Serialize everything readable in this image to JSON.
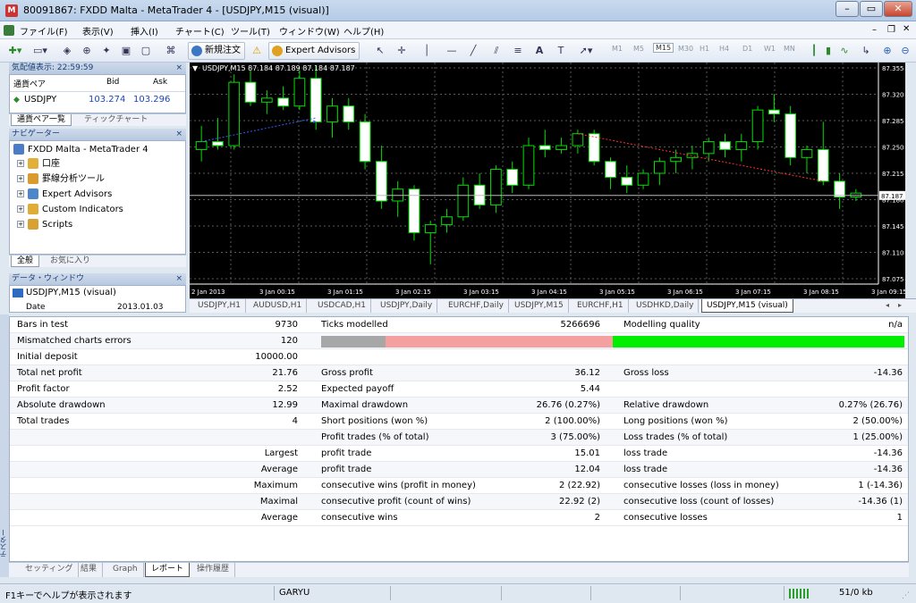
{
  "window": {
    "title": "80091867: FXDD Malta - MetaTrader 4 - [USDJPY,M15 (visual)]"
  },
  "menu": [
    "ファイル(F)",
    "表示(V)",
    "挿入(I)",
    "チャート(C)",
    "ツール(T)",
    "ウィンドウ(W)",
    "ヘルプ(H)"
  ],
  "toolbar": {
    "new_order": "新規注文",
    "expert_advisors": "Expert Advisors",
    "timeframes": [
      "M1",
      "M5",
      "M15",
      "M30",
      "H1",
      "H4",
      "D1",
      "W1",
      "MN"
    ],
    "active_timeframe": "M15"
  },
  "market_watch": {
    "header": "気配値表示: 22:59:59",
    "columns": [
      "通貨ペア",
      "Bid",
      "Ask"
    ],
    "rows": [
      {
        "symbol": "USDJPY",
        "bid": "103.274",
        "ask": "103.296"
      }
    ],
    "tabs": [
      "通貨ペア一覧",
      "ティックチャート"
    ]
  },
  "navigator": {
    "header": "ナビゲーター",
    "root": "FXDD Malta - MetaTrader 4",
    "items": [
      "口座",
      "罫線分析ツール",
      "Expert Advisors",
      "Custom Indicators",
      "Scripts"
    ],
    "tabs": [
      "全般",
      "お気に入り"
    ]
  },
  "data_window": {
    "header": "データ・ウィンドウ",
    "symbol": "USDJPY,M15 (visual)",
    "date_label": "Date",
    "date_value": "2013.01.03"
  },
  "chart_data": {
    "type": "candlestick",
    "title": "USDJPY,M15  87.184 87.189 87.184 87.187",
    "y_ticks": [
      "87.355",
      "87.320",
      "87.285",
      "87.250",
      "87.215",
      "87.180",
      "87.145",
      "87.110",
      "87.075"
    ],
    "ylim": [
      87.075,
      87.355
    ],
    "current_price": "87.187",
    "x_ticks": [
      "2 Jan 2013",
      "3 Jan 00:15",
      "3 Jan 01:15",
      "3 Jan 02:15",
      "3 Jan 03:15",
      "3 Jan 04:15",
      "3 Jan 05:15",
      "3 Jan 06:15",
      "3 Jan 07:15",
      "3 Jan 08:15",
      "3 Jan 09:15"
    ],
    "candles": [
      [
        87.245,
        87.275,
        87.23,
        87.255
      ],
      [
        87.255,
        87.285,
        87.245,
        87.25
      ],
      [
        87.25,
        87.34,
        87.245,
        87.33
      ],
      [
        87.33,
        87.345,
        87.3,
        87.305
      ],
      [
        87.305,
        87.32,
        87.29,
        87.31
      ],
      [
        87.31,
        87.325,
        87.295,
        87.3
      ],
      [
        87.3,
        87.345,
        87.295,
        87.335
      ],
      [
        87.335,
        87.35,
        87.27,
        87.28
      ],
      [
        87.28,
        87.31,
        87.26,
        87.3
      ],
      [
        87.3,
        87.31,
        87.27,
        87.28
      ],
      [
        87.28,
        87.29,
        87.22,
        87.23
      ],
      [
        87.23,
        87.25,
        87.17,
        87.18
      ],
      [
        87.18,
        87.205,
        87.16,
        87.195
      ],
      [
        87.195,
        87.2,
        87.13,
        87.14
      ],
      [
        87.14,
        87.155,
        87.1,
        87.15
      ],
      [
        87.15,
        87.17,
        87.14,
        87.16
      ],
      [
        87.16,
        87.21,
        87.155,
        87.2
      ],
      [
        87.2,
        87.215,
        87.17,
        87.175
      ],
      [
        87.175,
        87.225,
        87.165,
        87.22
      ],
      [
        87.22,
        87.23,
        87.19,
        87.2
      ],
      [
        87.2,
        87.26,
        87.195,
        87.25
      ],
      [
        87.25,
        87.27,
        87.235,
        87.245
      ],
      [
        87.245,
        87.26,
        87.24,
        87.25
      ],
      [
        87.25,
        87.27,
        87.24,
        87.265
      ],
      [
        87.265,
        87.27,
        87.225,
        87.23
      ],
      [
        87.23,
        87.235,
        87.195,
        87.21
      ],
      [
        87.21,
        87.225,
        87.19,
        87.2
      ],
      [
        87.2,
        87.22,
        87.195,
        87.215
      ],
      [
        87.215,
        87.235,
        87.2,
        87.23
      ],
      [
        87.23,
        87.245,
        87.215,
        87.235
      ],
      [
        87.235,
        87.25,
        87.22,
        87.24
      ],
      [
        87.24,
        87.26,
        87.23,
        87.255
      ],
      [
        87.255,
        87.265,
        87.235,
        87.245
      ],
      [
        87.245,
        87.265,
        87.23,
        87.255
      ],
      [
        87.255,
        87.3,
        87.245,
        87.295
      ],
      [
        87.295,
        87.315,
        87.28,
        87.29
      ],
      [
        87.29,
        87.3,
        87.225,
        87.235
      ],
      [
        87.235,
        87.25,
        87.215,
        87.245
      ],
      [
        87.245,
        87.28,
        87.2,
        87.205
      ],
      [
        87.205,
        87.215,
        87.17,
        87.185
      ],
      [
        87.185,
        87.195,
        87.18,
        87.19
      ]
    ]
  },
  "chart_tabs": [
    "USDJPY,H1",
    "AUDUSD,H1",
    "USDCAD,H1",
    "USDJPY,Daily",
    "EURCHF,Daily",
    "USDJPY,M15",
    "EURCHF,H1",
    "USDHKD,Daily",
    "USDJPY,M15 (visual)"
  ],
  "report": {
    "rows": [
      [
        "Bars in test",
        "9730",
        "Ticks modelled",
        "5266696",
        "Modelling quality",
        "n/a"
      ],
      [
        "Mismatched charts errors",
        "120",
        "",
        "",
        "",
        ""
      ],
      [
        "Initial deposit",
        "10000.00",
        "",
        "",
        "",
        ""
      ],
      [
        "Total net profit",
        "21.76",
        "Gross profit",
        "36.12",
        "Gross loss",
        "-14.36"
      ],
      [
        "Profit factor",
        "2.52",
        "Expected payoff",
        "5.44",
        "",
        ""
      ],
      [
        "Absolute drawdown",
        "12.99",
        "Maximal drawdown",
        "26.76 (0.27%)",
        "Relative drawdown",
        "0.27% (26.76)"
      ],
      [
        "Total trades",
        "4",
        "Short positions (won %)",
        "2 (100.00%)",
        "Long positions (won %)",
        "2 (50.00%)"
      ],
      [
        "",
        "",
        "Profit trades (% of total)",
        "3 (75.00%)",
        "Loss trades (% of total)",
        "1 (25.00%)"
      ],
      [
        "",
        "Largest",
        "profit trade",
        "15.01",
        "loss trade",
        "-14.36"
      ],
      [
        "",
        "Average",
        "profit trade",
        "12.04",
        "loss trade",
        "-14.36"
      ],
      [
        "",
        "Maximum",
        "consecutive wins (profit in money)",
        "2 (22.92)",
        "consecutive losses (loss in money)",
        "1 (-14.36)"
      ],
      [
        "",
        "Maximal",
        "consecutive profit (count of wins)",
        "22.92 (2)",
        "consecutive loss (count of losses)",
        "-14.36 (1)"
      ],
      [
        "",
        "Average",
        "consecutive wins",
        "2",
        "consecutive losses",
        "1"
      ]
    ],
    "quality_bar": {
      "grey": 0.11,
      "pink": 0.39,
      "green": 0.5
    },
    "colors": {
      "grey": "#a7a7a7",
      "pink": "#f4a0a0",
      "green": "#00ef00"
    }
  },
  "tester_tabs": [
    "セッティング",
    "結果",
    "Graph",
    "レポート",
    "操作履歴"
  ],
  "tester_side_label": "テスター",
  "status": {
    "help": "F1キーでヘルプが表示されます",
    "profile": "GARYU",
    "traffic": "51/0 kb"
  }
}
